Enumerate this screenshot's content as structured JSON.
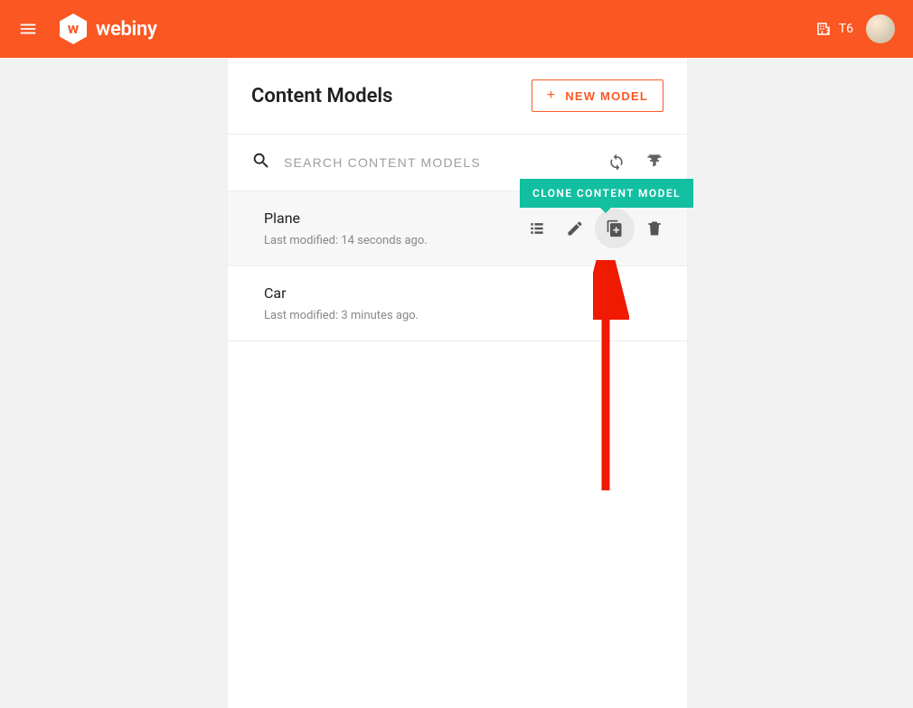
{
  "header": {
    "brand": "webiny",
    "brand_initial": "w",
    "tenant_label": "T6"
  },
  "page": {
    "title": "Content Models",
    "new_button_label": "NEW MODEL",
    "search_placeholder": "SEARCH CONTENT MODELS"
  },
  "tooltip": {
    "label": "CLONE CONTENT MODEL"
  },
  "models": [
    {
      "name": "Plane",
      "modified": "Last modified: 14 seconds ago."
    },
    {
      "name": "Car",
      "modified": "Last modified: 3 minutes ago."
    }
  ]
}
